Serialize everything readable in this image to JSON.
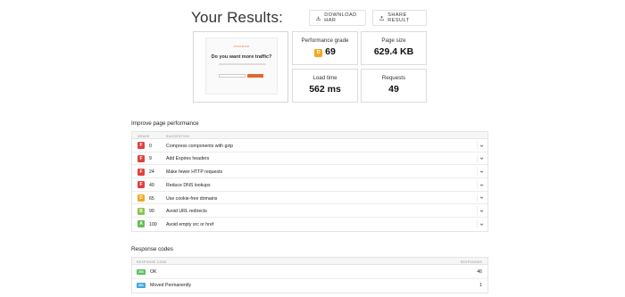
{
  "header": {
    "title": "Your Results:",
    "download_har": "DOWNLOAD HAR",
    "share_result": "SHARE RESULT"
  },
  "screenshot": {
    "brand": "PINGDOM",
    "headline": "Do you want more traffic?"
  },
  "metrics": {
    "performance_grade": {
      "label": "Performance grade",
      "grade": "D",
      "value": "69",
      "grade_color": "#f5a623"
    },
    "page_size": {
      "label": "Page size",
      "value": "629.4 KB"
    },
    "load_time": {
      "label": "Load time",
      "value": "562 ms"
    },
    "requests": {
      "label": "Requests",
      "value": "49"
    }
  },
  "improve": {
    "heading": "Improve page performance",
    "col_grade": "GRADE",
    "col_suggestion": "SUGGESTION",
    "rows": [
      {
        "grade": "F",
        "score": "0",
        "suggestion": "Compress components with gzip",
        "color": "#e0413c"
      },
      {
        "grade": "F",
        "score": "9",
        "suggestion": "Add Expires headers",
        "color": "#e0413c"
      },
      {
        "grade": "F",
        "score": "24",
        "suggestion": "Make fewer HTTP requests",
        "color": "#e0413c"
      },
      {
        "grade": "F",
        "score": "40",
        "suggestion": "Reduce DNS lookups",
        "color": "#e0413c"
      },
      {
        "grade": "D",
        "score": "65",
        "suggestion": "Use cookie-free domains",
        "color": "#f5a623"
      },
      {
        "grade": "B",
        "score": "90",
        "suggestion": "Avoid URL redirects",
        "color": "#8bc34a"
      },
      {
        "grade": "A",
        "score": "100",
        "suggestion": "Avoid empty src or href",
        "color": "#66bb55"
      }
    ]
  },
  "responses": {
    "heading": "Response codes",
    "col_code": "RESPONSE CODE",
    "col_responses": "RESPONSES",
    "rows": [
      {
        "code": "200",
        "label": "OK",
        "count": "46",
        "color": "#5cc15c"
      },
      {
        "code": "301",
        "label": "Moved Permanently",
        "count": "1",
        "color": "#3fa9e0"
      }
    ]
  }
}
